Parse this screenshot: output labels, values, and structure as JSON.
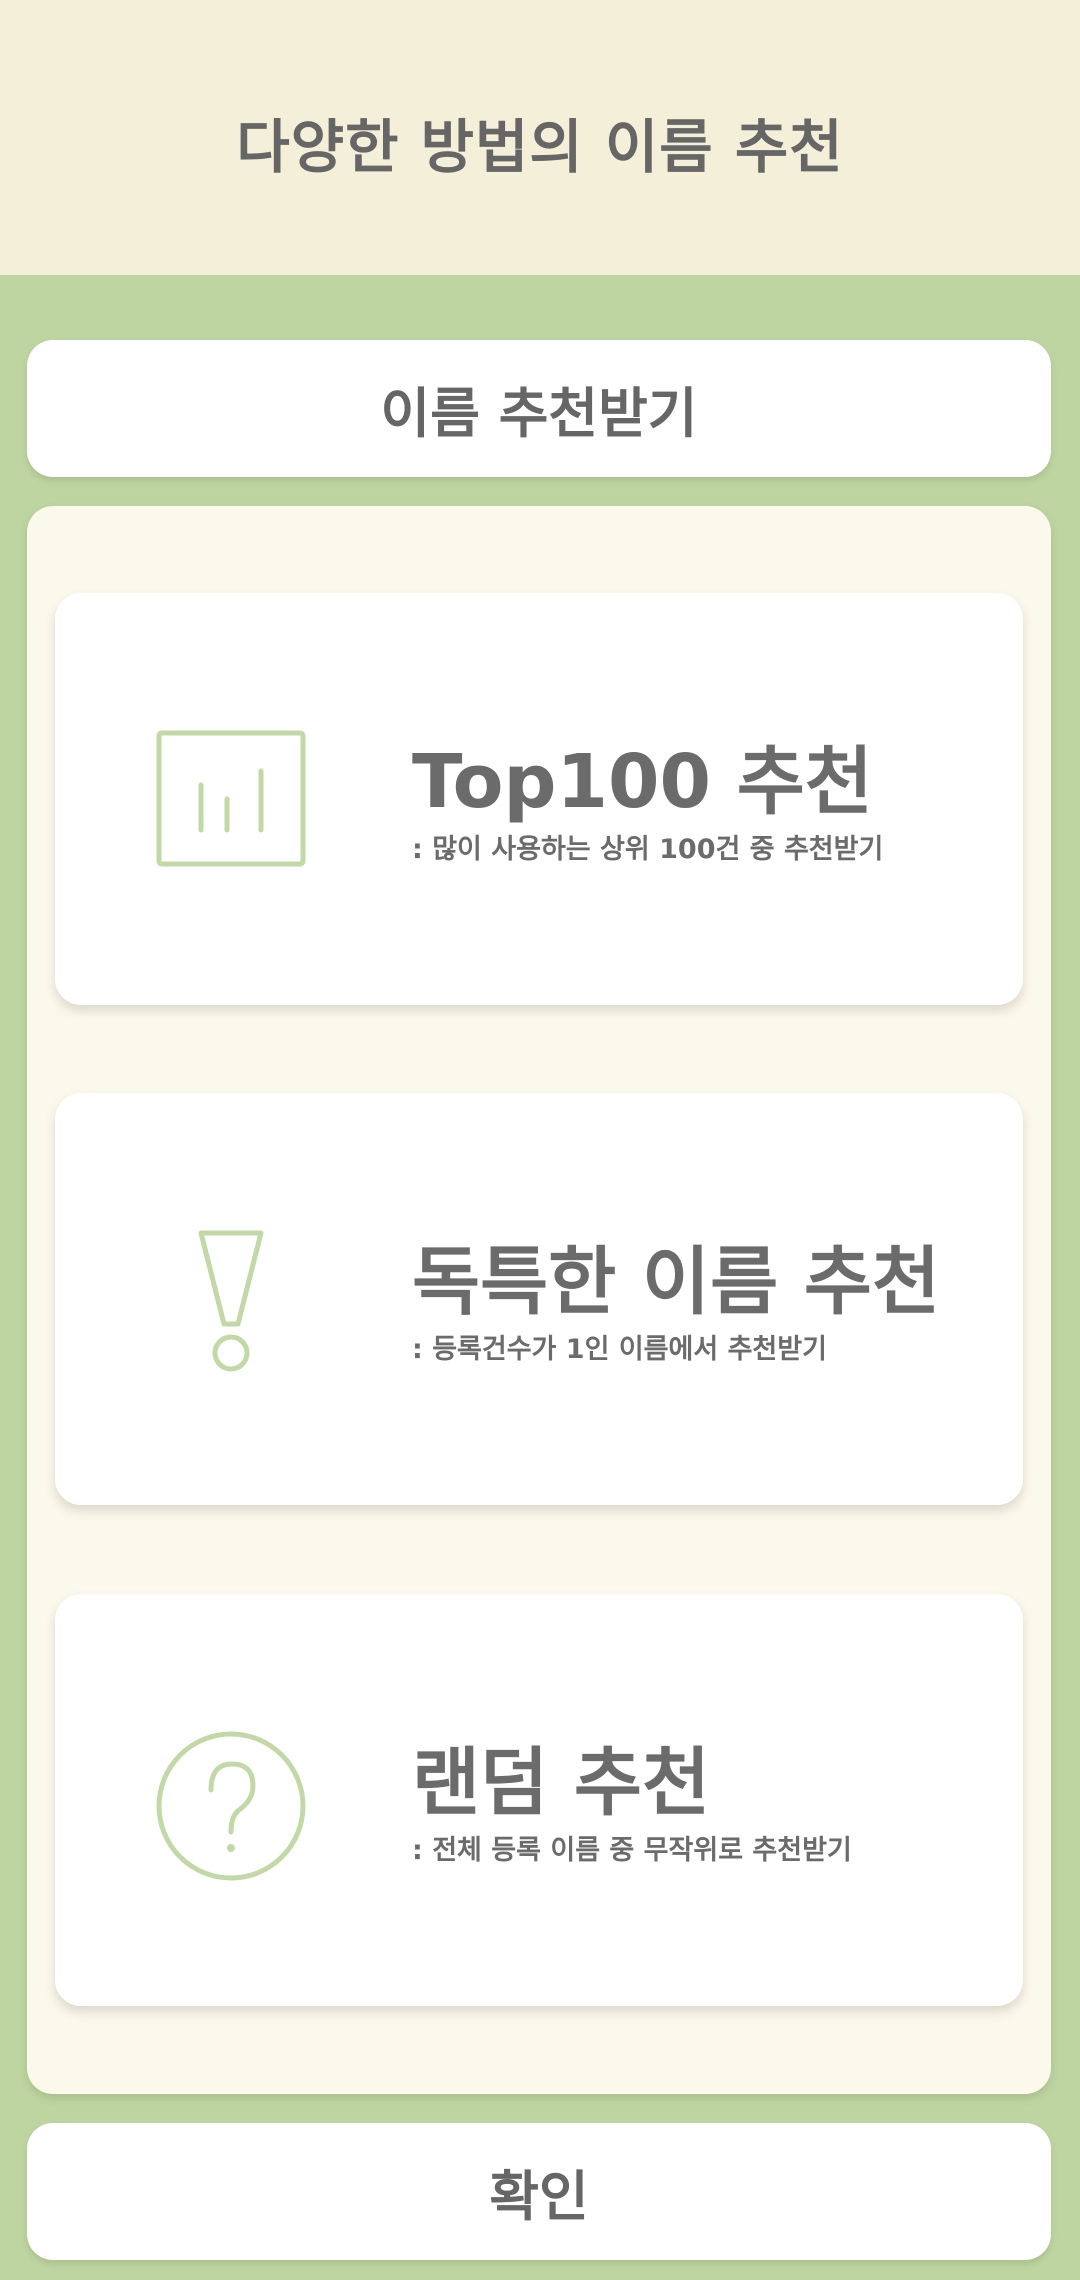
{
  "header": {
    "title": "다양한 방법의 이름 추천"
  },
  "top_button": {
    "label": "이름 추천받기"
  },
  "options": [
    {
      "icon": "bar-chart-icon",
      "title": "Top100 추천",
      "description": ": 많이 사용하는 상위 100건 중 추천받기"
    },
    {
      "icon": "exclamation-icon",
      "title": "독특한 이름 추천",
      "description": ": 등록건수가 1인 이름에서 추천받기"
    },
    {
      "icon": "question-circle-icon",
      "title": "랜덤 추천",
      "description": ": 전체 등록 이름 중 무작위로 추천받기"
    }
  ],
  "confirm_button": {
    "label": "확인"
  },
  "colors": {
    "header_bg": "#f4efd8",
    "accent_green": "#bed4a1",
    "panel_bg": "#fbf8ec",
    "icon_green": "#c2d8a6",
    "text": "#6b6b6b"
  }
}
